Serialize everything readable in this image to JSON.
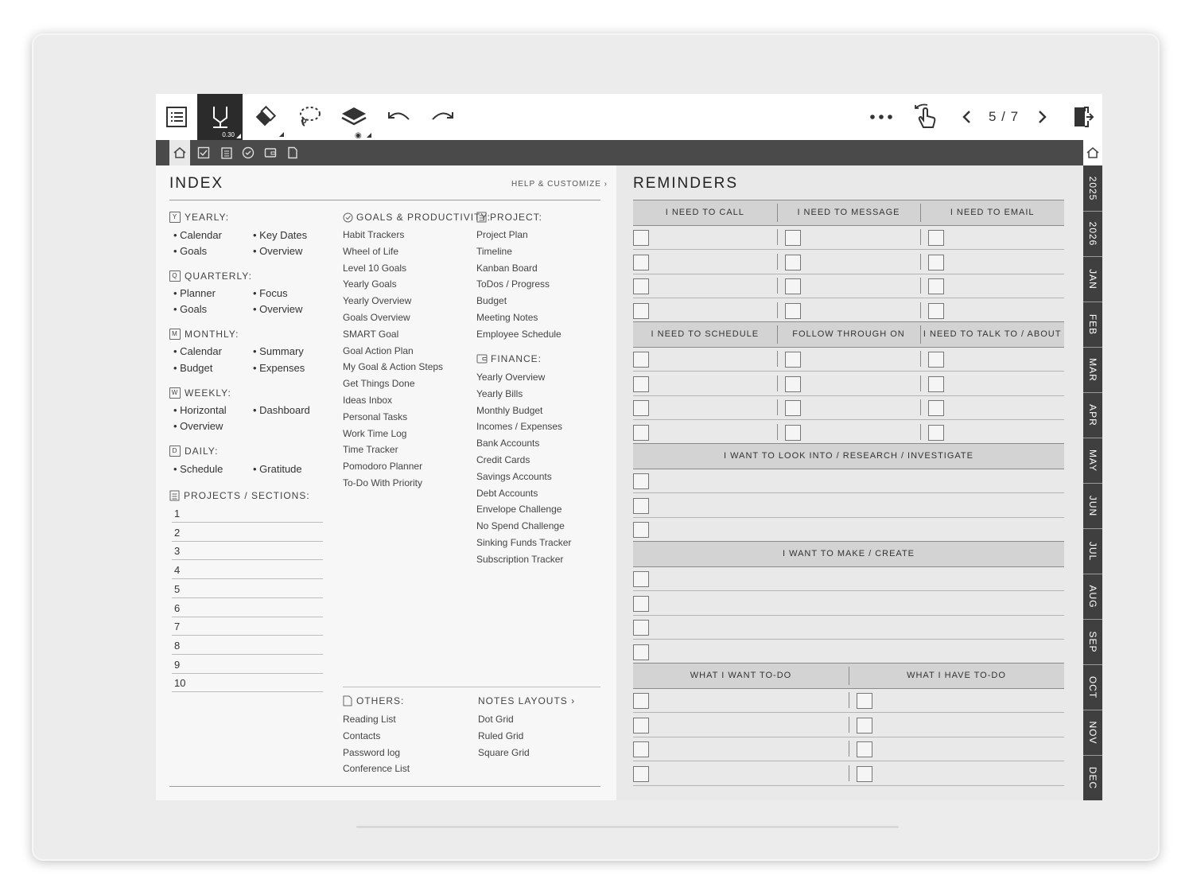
{
  "toolbar": {
    "pen_size": "0.30",
    "page_indicator": "5 / 7",
    "icons": [
      "list-icon",
      "pen-icon",
      "eraser-icon",
      "lasso-icon",
      "layers-icon",
      "undo-icon",
      "redo-icon",
      "more-icon",
      "touch-icon",
      "prev-icon",
      "next-icon",
      "exit-icon"
    ]
  },
  "tabs": [
    "home-icon",
    "check-icon",
    "notes-icon",
    "goal-icon",
    "wallet-icon",
    "page-icon"
  ],
  "side_tabs": [
    "2025",
    "2026",
    "JAN",
    "FEB",
    "MAR",
    "APR",
    "MAY",
    "JUN",
    "JUL",
    "AUG",
    "SEP",
    "OCT",
    "NOV",
    "DEC"
  ],
  "index": {
    "title": "INDEX",
    "help": "HELP & CUSTOMIZE ›",
    "yearly": {
      "label": "YEARLY:",
      "icon": "Y",
      "items": [
        "• Calendar",
        "• Key Dates",
        "• Goals",
        "• Overview"
      ]
    },
    "quarterly": {
      "label": "QUARTERLY:",
      "icon": "Q",
      "items": [
        "• Planner",
        "• Focus",
        "• Goals",
        "• Overview"
      ]
    },
    "monthly": {
      "label": "MONTHLY:",
      "icon": "M",
      "items": [
        "• Calendar",
        "• Summary",
        "• Budget",
        "• Expenses"
      ]
    },
    "weekly": {
      "label": "WEEKLY:",
      "icon": "W",
      "items": [
        "• Horizontal",
        "• Dashboard",
        "• Overview"
      ]
    },
    "daily": {
      "label": "DAILY:",
      "icon": "D",
      "items": [
        "• Schedule",
        "• Gratitude"
      ]
    },
    "projects": {
      "label": "PROJECTS / SECTIONS:",
      "numbers": [
        "1",
        "2",
        "3",
        "4",
        "5",
        "6",
        "7",
        "8",
        "9",
        "10"
      ]
    },
    "goals": {
      "label": "GOALS & PRODUCTIVITY:",
      "items": [
        "Habit Trackers",
        "Wheel of Life",
        "Level 10 Goals",
        "Yearly Goals",
        "Yearly Overview",
        "Goals Overview",
        "SMART Goal",
        "Goal Action Plan",
        "My Goal & Action Steps",
        "Get Things Done",
        "Ideas Inbox",
        "Personal Tasks",
        "Work Time Log",
        "Time Tracker",
        "Pomodoro Planner",
        "To-Do With Priority"
      ]
    },
    "project": {
      "label": "PROJECT:",
      "items": [
        "Project Plan",
        "Timeline",
        "Kanban Board",
        "ToDos / Progress",
        "Budget",
        "Meeting Notes",
        "Employee Schedule"
      ]
    },
    "finance": {
      "label": "FINANCE:",
      "items": [
        "Yearly Overview",
        "Yearly Bills",
        "Monthly Budget",
        "Incomes / Expenses",
        "Bank Accounts",
        "Credit Cards",
        "Savings Accounts",
        "Debt Accounts",
        "Envelope Challenge",
        "No Spend Challenge",
        "Sinking Funds Tracker",
        "Subscription Tracker"
      ]
    },
    "others": {
      "label": "OTHERS:",
      "items": [
        "Reading List",
        "Contacts",
        "Password log",
        "Conference List"
      ]
    },
    "notes": {
      "label": "NOTES LAYOUTS ›",
      "items": [
        "Dot Grid",
        "Ruled Grid",
        "Square Grid"
      ]
    }
  },
  "reminders": {
    "title": "REMINDERS",
    "block1": [
      "I NEED TO CALL",
      "I NEED TO MESSAGE",
      "I NEED TO EMAIL"
    ],
    "block2": [
      "I NEED TO SCHEDULE",
      "FOLLOW THROUGH ON",
      "I NEED TO TALK TO / ABOUT"
    ],
    "block3": "I WANT TO LOOK INTO / RESEARCH / INVESTIGATE",
    "block4": "I WANT TO MAKE / CREATE",
    "block5": [
      "WHAT I WANT TO-DO",
      "WHAT I HAVE TO-DO"
    ]
  }
}
